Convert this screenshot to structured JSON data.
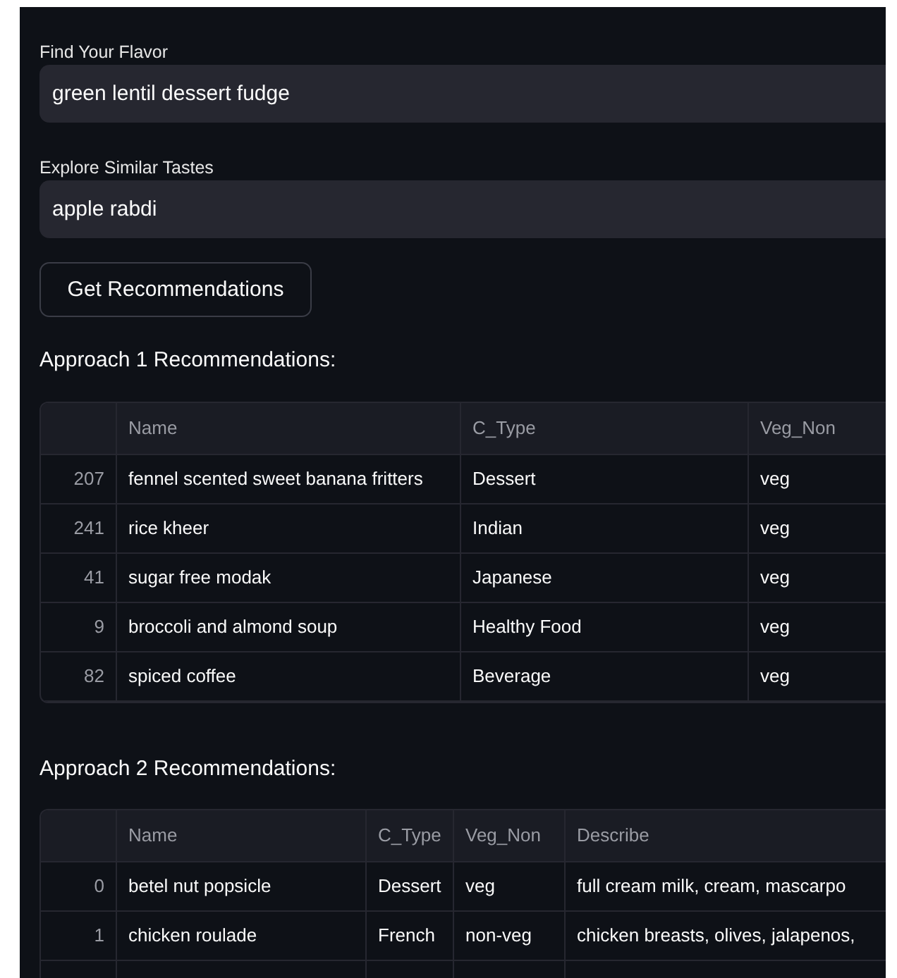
{
  "fields": [
    {
      "label": "Find Your Flavor",
      "value": "green lentil dessert fudge"
    },
    {
      "label": "Explore Similar Tastes",
      "value": "apple rabdi"
    }
  ],
  "button": "Get Recommendations",
  "tables": [
    {
      "heading": "Approach 1 Recommendations:",
      "columns": [
        "Name",
        "C_Type",
        "Veg_Non"
      ],
      "rows": [
        {
          "index": "207",
          "cells": [
            "fennel scented sweet banana fritters",
            "Dessert",
            "veg"
          ]
        },
        {
          "index": "241",
          "cells": [
            "rice kheer",
            "Indian",
            "veg"
          ]
        },
        {
          "index": "41",
          "cells": [
            "sugar free modak",
            "Japanese",
            "veg"
          ]
        },
        {
          "index": "9",
          "cells": [
            "broccoli and almond soup",
            "Healthy Food",
            "veg"
          ]
        },
        {
          "index": "82",
          "cells": [
            "spiced coffee",
            "Beverage",
            "veg"
          ]
        }
      ]
    },
    {
      "heading": "Approach 2 Recommendations:",
      "columns": [
        "Name",
        "C_Type",
        "Veg_Non",
        "Describe"
      ],
      "rows": [
        {
          "index": "0",
          "cells": [
            "betel nut popsicle",
            "Dessert",
            "veg",
            "full cream milk, cream, mascarpo"
          ]
        },
        {
          "index": "1",
          "cells": [
            "chicken roulade",
            "French",
            "non-veg",
            "chicken breasts, olives, jalapenos,"
          ]
        }
      ]
    }
  ]
}
